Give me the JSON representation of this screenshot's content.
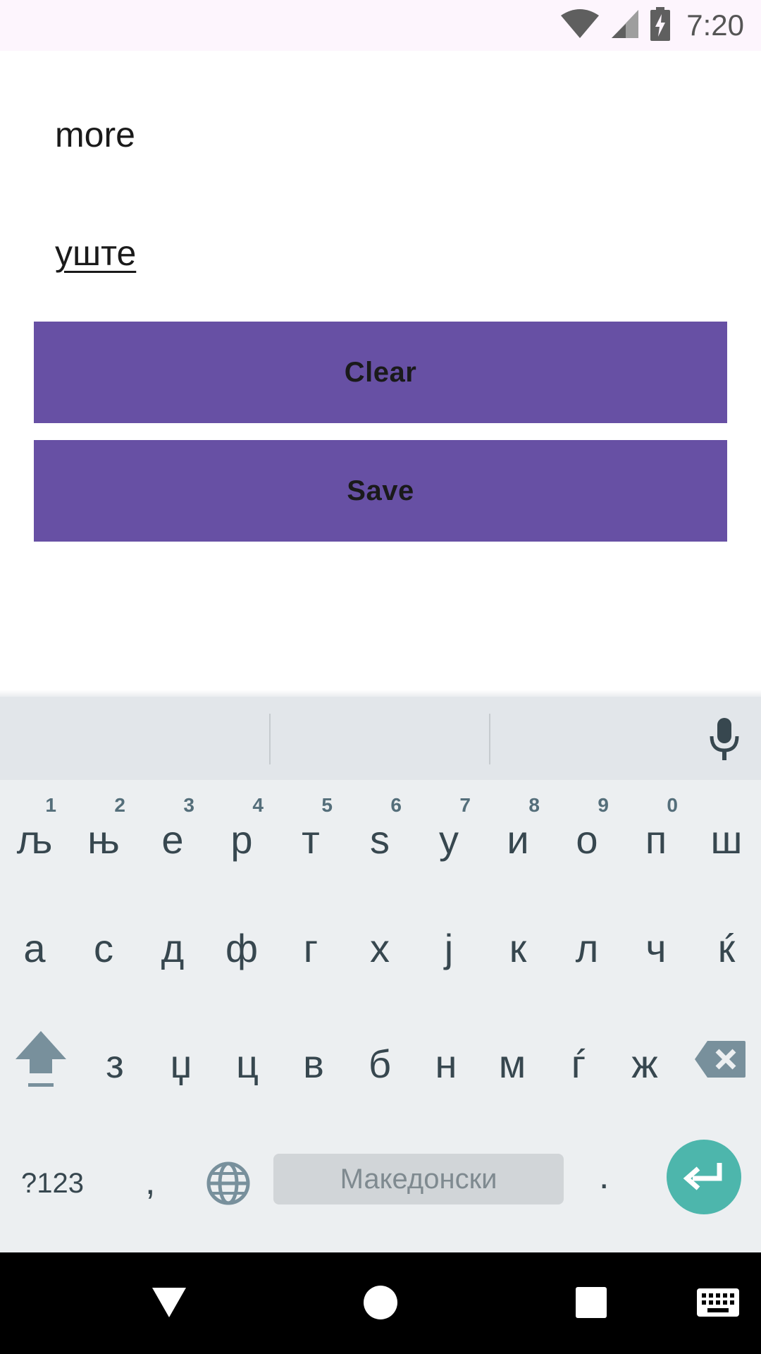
{
  "status_bar": {
    "time": "7:20",
    "icons": [
      "wifi-icon",
      "cell-signal-icon",
      "battery-charging-icon"
    ]
  },
  "form": {
    "word_value": "more",
    "translation_value": "уште",
    "clear_label": "Clear",
    "save_label": "Save"
  },
  "colors": {
    "button_bg": "#6750a4",
    "enter_key": "#4db6ac",
    "keyboard_bg": "#eceff1"
  },
  "keyboard": {
    "row1": [
      {
        "ch": "љ",
        "hint": "1"
      },
      {
        "ch": "њ",
        "hint": "2"
      },
      {
        "ch": "е",
        "hint": "3"
      },
      {
        "ch": "р",
        "hint": "4"
      },
      {
        "ch": "т",
        "hint": "5"
      },
      {
        "ch": "ѕ",
        "hint": "6"
      },
      {
        "ch": "у",
        "hint": "7"
      },
      {
        "ch": "и",
        "hint": "8"
      },
      {
        "ch": "о",
        "hint": "9"
      },
      {
        "ch": "п",
        "hint": "0"
      },
      {
        "ch": "ш",
        "hint": ""
      }
    ],
    "row2": [
      "а",
      "с",
      "д",
      "ф",
      "г",
      "х",
      "ј",
      "к",
      "л",
      "ч",
      "ќ"
    ],
    "row3": [
      "з",
      "џ",
      "ц",
      "в",
      "б",
      "н",
      "м",
      "ѓ",
      "ж"
    ],
    "symbols_label": "?123",
    "comma": ",",
    "space_label": "Македонски",
    "period": "."
  },
  "nav_bar": {
    "icons": [
      "back-icon",
      "home-icon",
      "recents-icon",
      "keyboard-switch-icon"
    ]
  }
}
